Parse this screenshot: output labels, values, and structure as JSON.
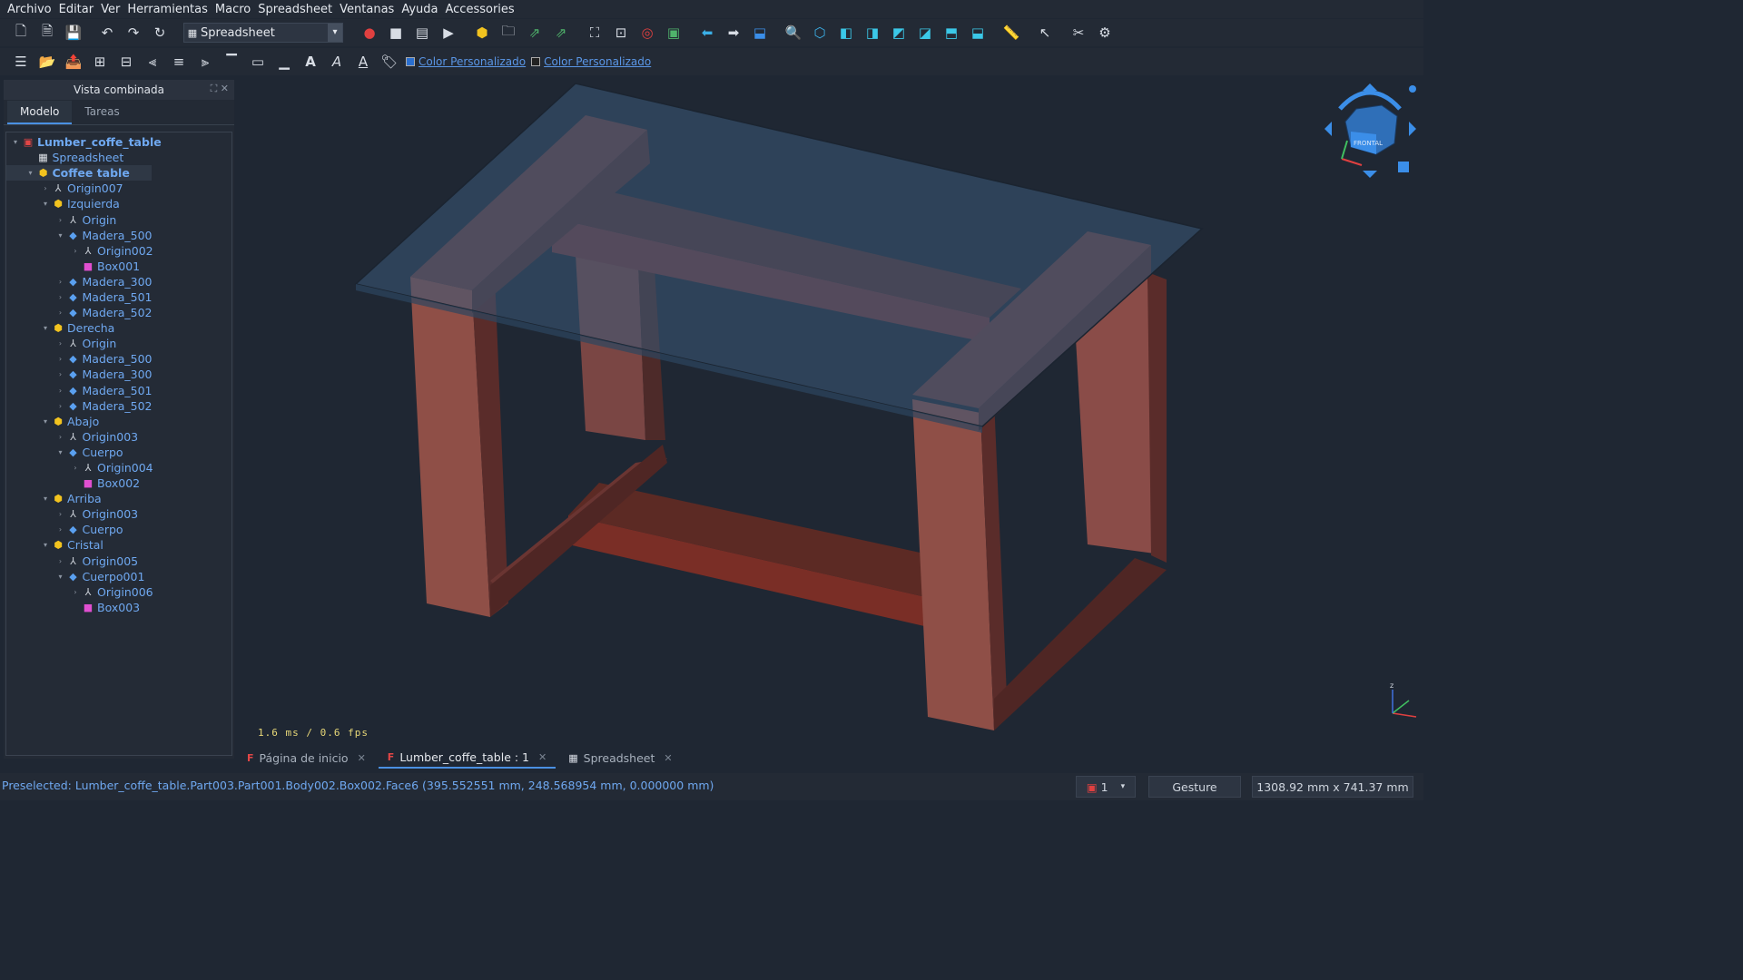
{
  "menu": [
    "Archivo",
    "Editar",
    "Ver",
    "Herramientas",
    "Macro",
    "Spreadsheet",
    "Ventanas",
    "Ayuda",
    "Accessories"
  ],
  "toolbar": {
    "workbench": "Spreadsheet",
    "color1": "Color Personalizado",
    "color2": "Color Personalizado"
  },
  "panel": {
    "title": "Vista combinada",
    "tabs": [
      "Modelo",
      "Tareas"
    ]
  },
  "tree": [
    {
      "label": "Lumber_coffe_table",
      "icon": "document-icon",
      "depth": 0,
      "expanded": true,
      "bold": true
    },
    {
      "label": "Spreadsheet",
      "icon": "spreadsheet-icon",
      "depth": 1,
      "expanded": null
    },
    {
      "label": "Coffee table",
      "icon": "part-icon",
      "depth": 1,
      "expanded": true,
      "bold": true,
      "selected": true
    },
    {
      "label": "Origin007",
      "icon": "origin-icon",
      "depth": 2,
      "expanded": false
    },
    {
      "label": "Izquierda",
      "icon": "part-icon",
      "depth": 2,
      "expanded": true
    },
    {
      "label": "Origin",
      "icon": "origin-icon",
      "depth": 3,
      "expanded": false
    },
    {
      "label": "Madera_500",
      "icon": "body-icon",
      "depth": 3,
      "expanded": true
    },
    {
      "label": "Origin002",
      "icon": "origin-icon",
      "depth": 4,
      "expanded": false
    },
    {
      "label": "Box001",
      "icon": "box-icon",
      "depth": 4,
      "expanded": null
    },
    {
      "label": "Madera_300",
      "icon": "body-icon",
      "depth": 3,
      "expanded": false
    },
    {
      "label": "Madera_501",
      "icon": "body-icon",
      "depth": 3,
      "expanded": false
    },
    {
      "label": "Madera_502",
      "icon": "body-icon",
      "depth": 3,
      "expanded": false
    },
    {
      "label": "Derecha",
      "icon": "part-icon",
      "depth": 2,
      "expanded": true
    },
    {
      "label": "Origin",
      "icon": "origin-icon",
      "depth": 3,
      "expanded": false
    },
    {
      "label": "Madera_500",
      "icon": "body-icon",
      "depth": 3,
      "expanded": false
    },
    {
      "label": "Madera_300",
      "icon": "body-icon",
      "depth": 3,
      "expanded": false
    },
    {
      "label": "Madera_501",
      "icon": "body-icon",
      "depth": 3,
      "expanded": false
    },
    {
      "label": "Madera_502",
      "icon": "body-icon",
      "depth": 3,
      "expanded": false
    },
    {
      "label": "Abajo",
      "icon": "part-icon",
      "depth": 2,
      "expanded": true
    },
    {
      "label": "Origin003",
      "icon": "origin-icon",
      "depth": 3,
      "expanded": false
    },
    {
      "label": "Cuerpo",
      "icon": "body-icon",
      "depth": 3,
      "expanded": true
    },
    {
      "label": "Origin004",
      "icon": "origin-icon",
      "depth": 4,
      "expanded": false
    },
    {
      "label": "Box002",
      "icon": "box-icon",
      "depth": 4,
      "expanded": null
    },
    {
      "label": "Arriba",
      "icon": "part-icon",
      "depth": 2,
      "expanded": true
    },
    {
      "label": "Origin003",
      "icon": "origin-icon",
      "depth": 3,
      "expanded": false
    },
    {
      "label": "Cuerpo",
      "icon": "body-icon",
      "depth": 3,
      "expanded": false
    },
    {
      "label": "Cristal",
      "icon": "part-icon",
      "depth": 2,
      "expanded": true
    },
    {
      "label": "Origin005",
      "icon": "origin-icon",
      "depth": 3,
      "expanded": false
    },
    {
      "label": "Cuerpo001",
      "icon": "body-icon",
      "depth": 3,
      "expanded": true
    },
    {
      "label": "Origin006",
      "icon": "origin-icon",
      "depth": 4,
      "expanded": false
    },
    {
      "label": "Box003",
      "icon": "box-icon",
      "depth": 4,
      "expanded": null
    }
  ],
  "viewport": {
    "fps": "1.6 ms / 0.6 fps",
    "navcube_face": "FRONTAL"
  },
  "doc_tabs": [
    {
      "label": "Página de inicio",
      "icon": "freecad-icon",
      "active": false
    },
    {
      "label": "Lumber_coffe_table : 1",
      "icon": "freecad-icon",
      "active": true
    },
    {
      "label": "Spreadsheet",
      "icon": "spreadsheet-icon",
      "active": false
    }
  ],
  "status": {
    "preselected": "Preselected: Lumber_coffe_table.Part003.Part001.Body002.Box002.Face6 (395.552551 mm, 248.568954 mm, 0.000000 mm)",
    "page": "1",
    "nav_style": "Gesture",
    "dimensions": "1308.92 mm x 741.37 mm"
  },
  "colors": {
    "wood_light": "#8a4c48",
    "wood_dark": "#5a2c2a",
    "glass": "#3a5a78",
    "accent": "#4a90e2"
  }
}
